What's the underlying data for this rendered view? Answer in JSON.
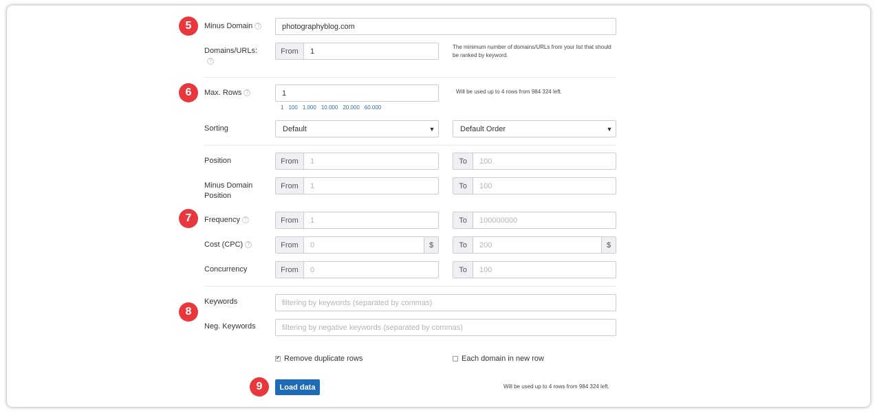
{
  "steps": [
    "5",
    "6",
    "7",
    "8",
    "9"
  ],
  "minus_domain": {
    "label": "Minus Domain",
    "value": "photographyblog.com"
  },
  "domains_urls": {
    "label": "Domains/URLs:",
    "from": "From",
    "value": "1",
    "hint": "The minimum number of domains/URLs from your list that should be ranked by keyword."
  },
  "max_rows": {
    "label": "Max. Rows",
    "value": "1",
    "hint": "Will be used up to 4 rows from 984 324 left.",
    "quick": [
      "1",
      "100",
      "1.000",
      "10.000",
      "20.000",
      "60.000"
    ]
  },
  "sorting": {
    "label": "Sorting",
    "value1": "Default",
    "value2": "Default Order"
  },
  "ranges": [
    {
      "label": "Position",
      "from": "1",
      "to": "100"
    },
    {
      "label": "Minus Domain Position",
      "from": "1",
      "to": "100"
    },
    {
      "label": "Frequency",
      "from": "1",
      "to": "100000000"
    },
    {
      "label": "Cost (CPC)",
      "from": "0",
      "to": "200",
      "unit": "$"
    },
    {
      "label": "Concurrency",
      "from": "0",
      "to": "100"
    }
  ],
  "from_label": "From",
  "to_label": "To",
  "help_glyph": "?",
  "keywords": {
    "label": "Keywords",
    "placeholder": "filtering by keywords (separated by commas)"
  },
  "neg_keywords": {
    "label": "Neg. Keywords",
    "placeholder": "filtering by negative keywords (separated by commas)"
  },
  "options": {
    "remove_duplicates": {
      "label": "Remove duplicate rows",
      "checked": true,
      "mark": "✔"
    },
    "each_domain": {
      "label": "Each domain in new row",
      "checked": false
    }
  },
  "load_button": "Load data",
  "footer_hint": "Will be used up to 4 rows from 984 324 left.",
  "colors": {
    "badge": "#e8383d",
    "button": "#1e6bb8",
    "link": "#2b6cb0"
  }
}
